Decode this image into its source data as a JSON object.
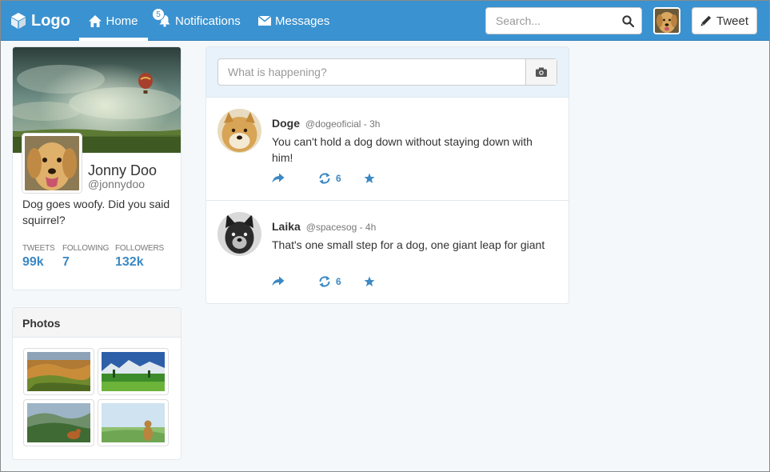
{
  "navbar": {
    "brand": "Logo",
    "items": [
      {
        "label": "Home",
        "icon": "home-icon"
      },
      {
        "label": "Notifications",
        "icon": "bell-icon",
        "badge": "5"
      },
      {
        "label": "Messages",
        "icon": "envelope-icon"
      }
    ],
    "search": {
      "placeholder": "Search...",
      "icon": "search-icon"
    },
    "tweet_button": "Tweet"
  },
  "profile": {
    "name": "Jonny Doo",
    "handle": "@jonnydoo",
    "bio": "Dog goes woofy. Did you said squirrel?",
    "stats": [
      {
        "label": "TWEETS",
        "value": "99k"
      },
      {
        "label": "FOLLOWING",
        "value": "7"
      },
      {
        "label": "FOLLOWERS",
        "value": "132k"
      }
    ]
  },
  "photos": {
    "title": "Photos"
  },
  "compose": {
    "placeholder": "What is happening?",
    "icon": "camera-icon"
  },
  "tweets": [
    {
      "name": "Doge",
      "meta": "@dogeoficial - 3h",
      "text": "You can't hold a dog down without staying down with him!",
      "retweets": "6"
    },
    {
      "name": "Laika",
      "meta": "@spacesog - 4h",
      "text": "That's one small step for a dog, one giant leap for giant",
      "retweets": "6"
    }
  ],
  "colors": {
    "navbar": "#3b92d0",
    "accent": "#3b88c3",
    "background": "#f5f8fa"
  }
}
